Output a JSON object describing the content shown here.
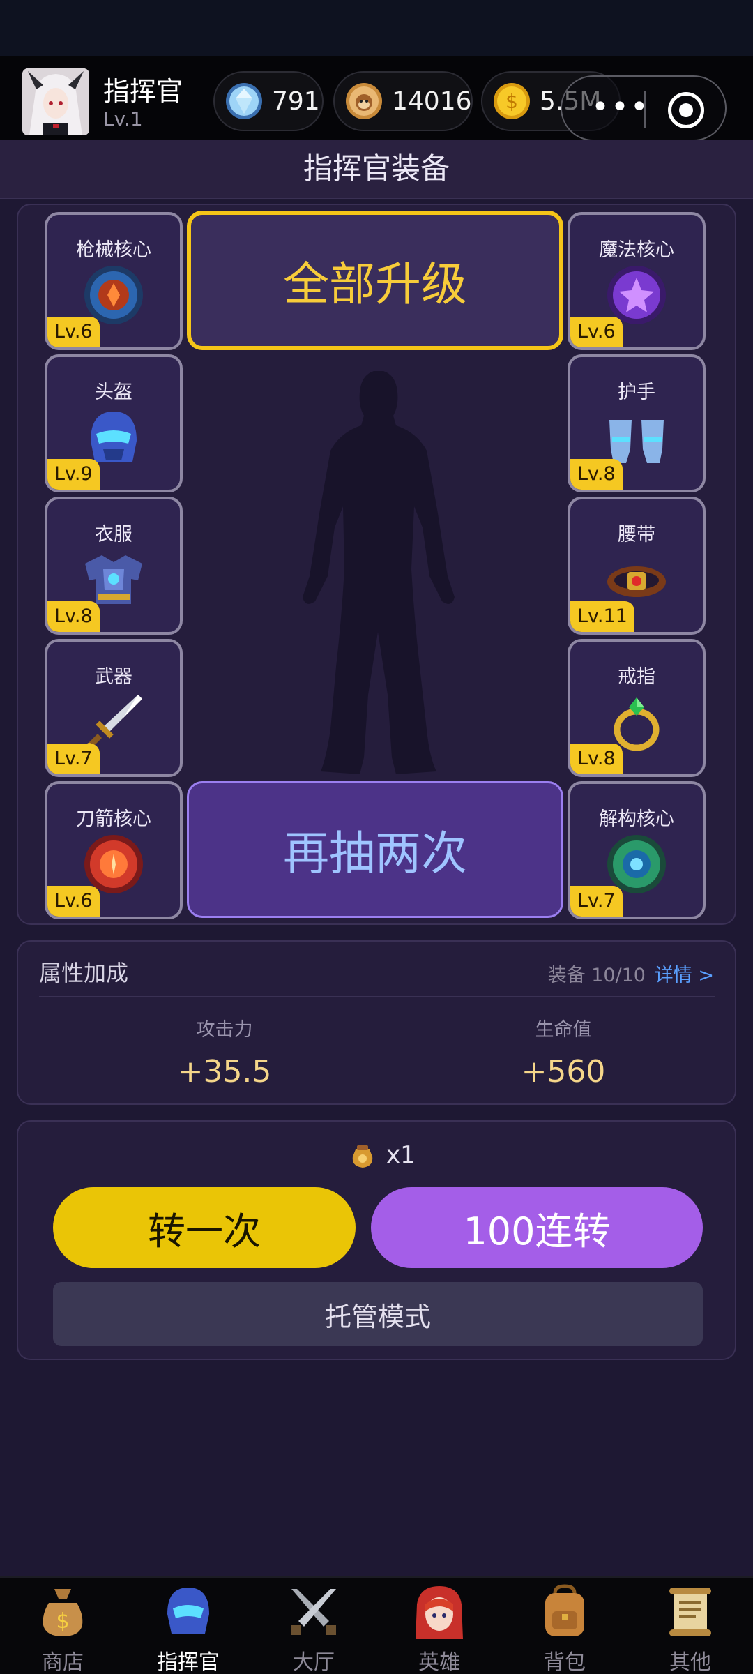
{
  "header": {
    "player_name": "指挥官",
    "player_level": "Lv.1",
    "currencies": [
      {
        "icon": "diamond-icon",
        "value": "791"
      },
      {
        "icon": "monkey-coin-icon",
        "value": "14016"
      },
      {
        "icon": "gold-coin-icon",
        "value": "5.5M"
      }
    ],
    "capsule": {
      "more_icon": "more-dots-icon",
      "close_icon": "target-icon"
    }
  },
  "page": {
    "title": "指挥官装备"
  },
  "equipment": {
    "left": [
      {
        "name": "枪械核心",
        "level": "Lv.6",
        "icon": "gun-core-icon"
      },
      {
        "name": "头盔",
        "level": "Lv.9",
        "icon": "helmet-icon"
      },
      {
        "name": "衣服",
        "level": "Lv.8",
        "icon": "armor-icon"
      },
      {
        "name": "武器",
        "level": "Lv.7",
        "icon": "sword-icon"
      },
      {
        "name": "刀箭核心",
        "level": "Lv.6",
        "icon": "blade-core-icon"
      }
    ],
    "right": [
      {
        "name": "魔法核心",
        "level": "Lv.6",
        "icon": "magic-core-icon"
      },
      {
        "name": "护手",
        "level": "Lv.8",
        "icon": "gauntlets-icon"
      },
      {
        "name": "腰带",
        "level": "Lv.11",
        "icon": "belt-icon"
      },
      {
        "name": "戒指",
        "level": "Lv.8",
        "icon": "ring-icon"
      },
      {
        "name": "解构核心",
        "level": "Lv.7",
        "icon": "deconstruct-core-icon"
      }
    ],
    "upgrade_all_label": "全部升级",
    "draw_again_label": "再抽两次"
  },
  "attributes": {
    "title": "属性加成",
    "equip_count": "装备 10/10",
    "detail_label": "详情 >",
    "stats": [
      {
        "label": "攻击力",
        "value": "+35.5"
      },
      {
        "label": "生命值",
        "value": "+560"
      }
    ]
  },
  "spin": {
    "token_count": "x1",
    "spin_once_label": "转一次",
    "spin_100_label": "100连转",
    "auto_mode_label": "托管模式"
  },
  "nav": {
    "items": [
      {
        "label": "商店",
        "icon": "money-bag-icon",
        "active": false
      },
      {
        "label": "指挥官",
        "icon": "commander-helmet-icon",
        "active": true
      },
      {
        "label": "大厅",
        "icon": "crossed-swords-icon",
        "active": false
      },
      {
        "label": "英雄",
        "icon": "hero-portrait-icon",
        "active": false
      },
      {
        "label": "背包",
        "icon": "backpack-icon",
        "active": false
      },
      {
        "label": "其他",
        "icon": "scroll-icon",
        "active": false
      }
    ]
  },
  "colors": {
    "background": "#1e1833",
    "panel": "#251d3c",
    "level_badge": "#f5c822",
    "upgrade_border": "#f5c518",
    "draw_button": "#4c3388",
    "spin_once": "#eac506",
    "spin_100": "#a45ee8",
    "detail_link": "#5aa0ff"
  }
}
